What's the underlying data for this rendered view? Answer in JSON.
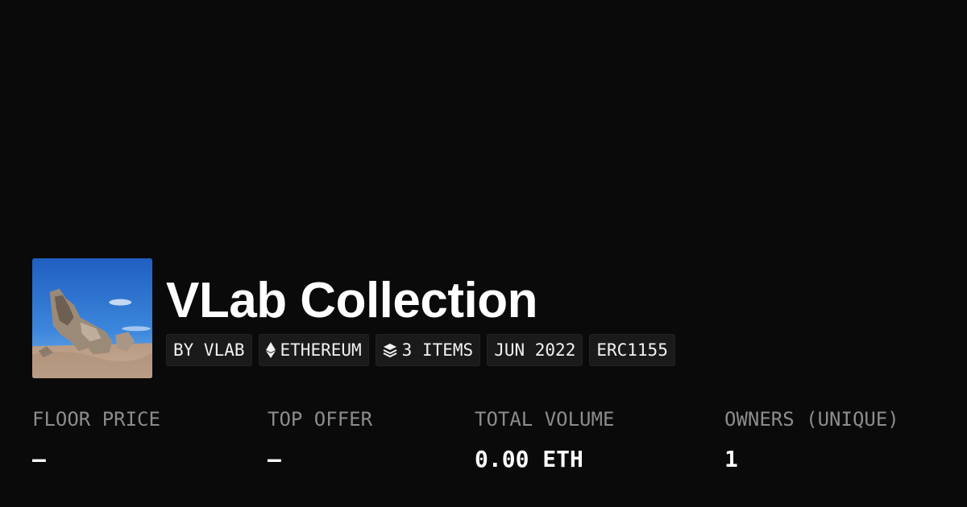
{
  "collection": {
    "name": "VLab Collection",
    "avatar_alt": "collection-avatar"
  },
  "badges": {
    "creator": "BY VLAB",
    "chain": "ETHEREUM",
    "chain_icon": "ethereum-icon",
    "items": "3 ITEMS",
    "items_icon": "layers-icon",
    "date": "JUN 2022",
    "standard": "ERC1155"
  },
  "stats": {
    "floor_price": {
      "label": "FLOOR PRICE",
      "value": "–"
    },
    "top_offer": {
      "label": "TOP OFFER",
      "value": "–"
    },
    "total_volume": {
      "label": "TOTAL VOLUME",
      "value": "0.00 ETH"
    },
    "owners": {
      "label": "OWNERS (UNIQUE)",
      "value": "1"
    }
  },
  "colors": {
    "background": "#0a0a0a",
    "badge_bg": "#1a1a1a",
    "label": "#8c8c8c",
    "text": "#ffffff"
  }
}
